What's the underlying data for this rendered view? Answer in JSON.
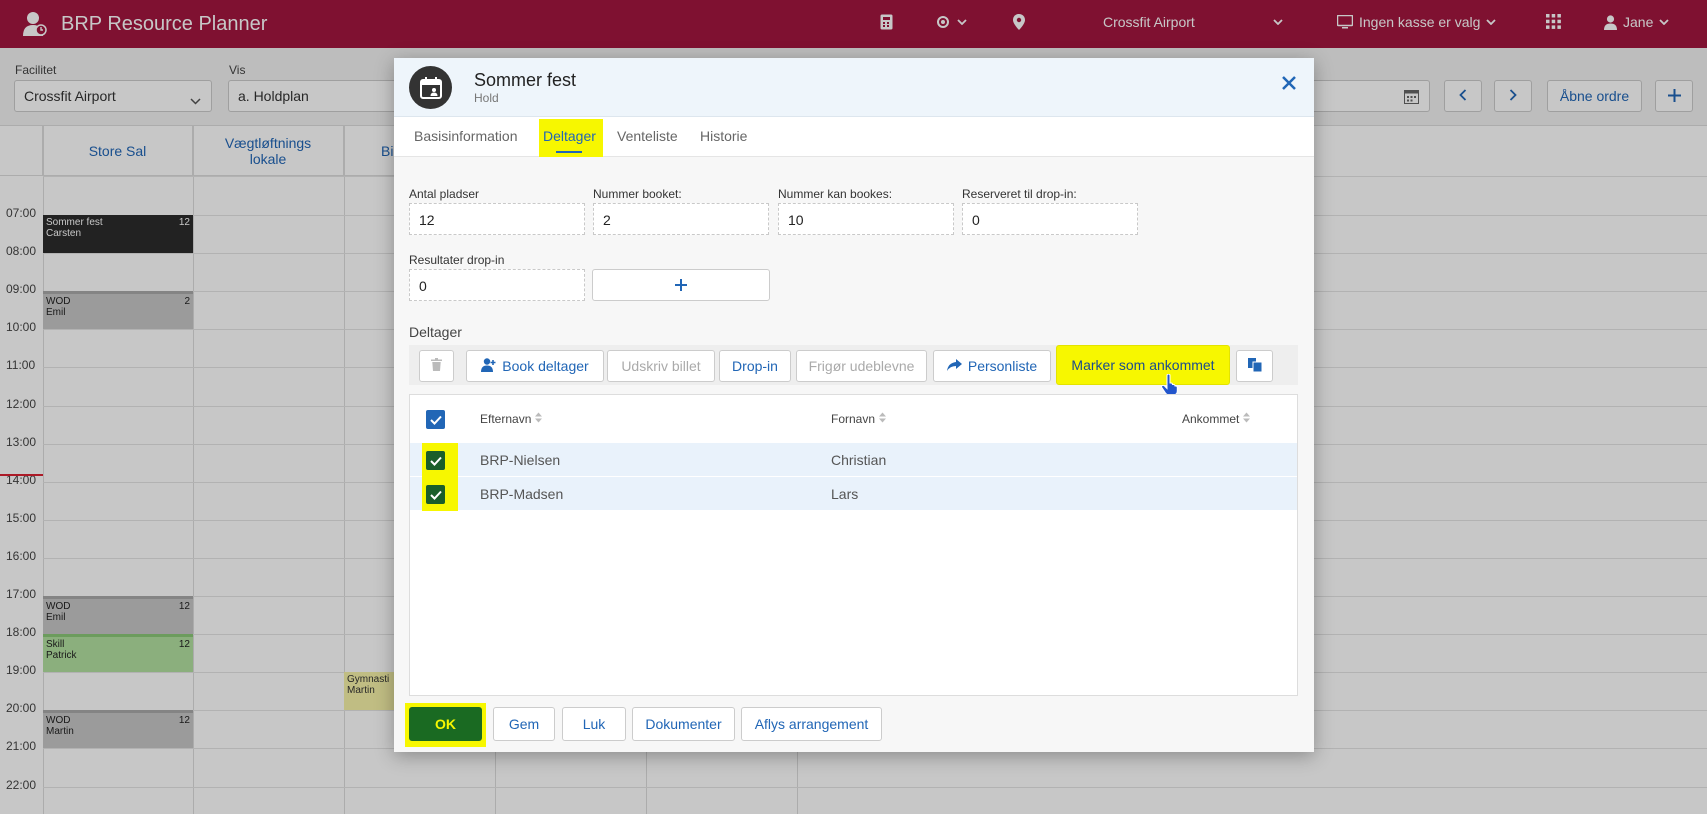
{
  "topbar": {
    "app_title": "BRP Resource Planner",
    "location": "Crossfit Airport",
    "register": "Ingen kasse er valg",
    "user": "Jane"
  },
  "toolbar": {
    "facility_label": "Facilitet",
    "facility_value": "Crossfit Airport",
    "view_label": "Vis",
    "view_value": "a. Holdplan",
    "open_orders": "Åbne ordre"
  },
  "calendar": {
    "columns": [
      "Store Sal",
      "Vægtløftnings lokale",
      "Bi"
    ],
    "times": [
      "07:00",
      "08:00",
      "09:00",
      "10:00",
      "11:00",
      "12:00",
      "13:00",
      "14:00",
      "15:00",
      "16:00",
      "17:00",
      "18:00",
      "19:00",
      "20:00",
      "21:00",
      "22:00"
    ],
    "events": [
      {
        "title": "Sommer fest",
        "person": "Carsten",
        "count": "12"
      },
      {
        "title": "WOD",
        "person": "Emil",
        "count": "2"
      },
      {
        "title": "WOD",
        "person": "Emil",
        "count": "12"
      },
      {
        "title": "Skill",
        "person": "Patrick",
        "count": "12"
      },
      {
        "title": "WOD",
        "person": "Martin",
        "count": "12"
      },
      {
        "title": "Gymnasti",
        "person": "Martin",
        "count": ""
      }
    ]
  },
  "modal": {
    "title": "Sommer fest",
    "subtitle": "Hold",
    "tabs": [
      "Basisinformation",
      "Deltager",
      "Venteliste",
      "Historie"
    ],
    "fields": {
      "seats_label": "Antal pladser",
      "seats_value": "12",
      "booked_label": "Nummer booket:",
      "booked_value": "2",
      "bookable_label": "Nummer kan bookes:",
      "bookable_value": "10",
      "reserved_label": "Reserveret til drop-in:",
      "reserved_value": "0",
      "results_label": "Resultater drop-in",
      "results_value": "0",
      "plus": "+"
    },
    "section_title": "Deltager",
    "actions": {
      "book": "Book deltager",
      "print": "Udskriv billet",
      "dropin": "Drop-in",
      "release": "Frigør udeblevne",
      "personlist": "Personliste",
      "mark_arrived": "Marker som ankommet"
    },
    "table": {
      "headers": [
        "Efternavn",
        "Fornavn",
        "Ankommet"
      ],
      "rows": [
        {
          "last": "BRP-Nielsen",
          "first": "Christian"
        },
        {
          "last": "BRP-Madsen",
          "first": "Lars"
        }
      ]
    },
    "footer": {
      "ok": "OK",
      "save": "Gem",
      "close": "Luk",
      "documents": "Dokumenter",
      "cancel_event": "Aflys arrangement"
    }
  }
}
